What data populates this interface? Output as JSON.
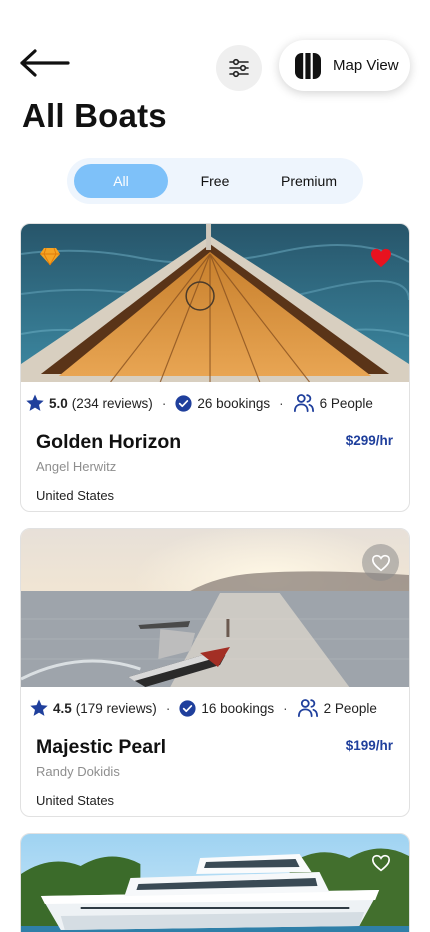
{
  "header": {
    "title": "All Boats",
    "map_view_label": "Map View"
  },
  "tabs": [
    {
      "label": "All",
      "active": true
    },
    {
      "label": "Free",
      "active": false
    },
    {
      "label": "Premium",
      "active": false
    }
  ],
  "boats": [
    {
      "name": "Golden Horizon",
      "owner": "Angel Herwitz",
      "country": "United States",
      "price": "$299/hr",
      "rating": "5.0",
      "reviews": "(234 reviews)",
      "bookings": "26 bookings",
      "people": "6 People",
      "favorite": true,
      "badge": "premium-gem-icon"
    },
    {
      "name": "Majestic Pearl",
      "owner": "Randy Dokidis",
      "country": "United States",
      "price": "$199/hr",
      "rating": "4.5",
      "reviews": "(179 reviews)",
      "bookings": "16 bookings",
      "people": "2 People",
      "favorite": false
    },
    {
      "favorite": false
    }
  ],
  "colors": {
    "accent": "#7ec1f9",
    "segment_bg": "#eef5fd",
    "price": "#1f3f9c",
    "star": "#1f3f9c",
    "heart_active": "#e8121f"
  },
  "icons": {
    "back": "arrow-left-icon",
    "filter": "sliders-icon",
    "map": "map-columns-icon",
    "rating": "star-icon",
    "bookings": "check-circle-icon",
    "people": "people-icon",
    "favorite": "heart-icon"
  }
}
